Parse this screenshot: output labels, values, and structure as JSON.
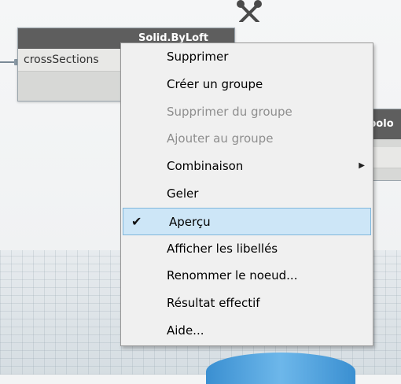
{
  "node_left": {
    "title": "Solid.ByLoft",
    "port_label": "crossSections"
  },
  "node_right": {
    "title_fragment": "polo"
  },
  "context_menu": {
    "items": [
      {
        "label": "Supprimer",
        "enabled": true
      },
      {
        "label": "Créer un groupe",
        "enabled": true
      },
      {
        "label": "Supprimer du groupe",
        "enabled": false
      },
      {
        "label": "Ajouter au groupe",
        "enabled": false
      },
      {
        "label": "Combinaison",
        "enabled": true,
        "submenu": true
      },
      {
        "label": "Geler",
        "enabled": true
      },
      {
        "label": "Aperçu",
        "enabled": true,
        "checked": true,
        "highlighted": true
      },
      {
        "label": "Afficher les libellés",
        "enabled": true
      },
      {
        "label": "Renommer le noeud...",
        "enabled": true
      },
      {
        "label": "Résultat effectif",
        "enabled": true
      },
      {
        "label": "Aide...",
        "enabled": true
      }
    ],
    "check_glyph": "✔",
    "submenu_arrow_glyph": "▶"
  },
  "icons": {
    "toolbar": "wrench-screwdriver-icon"
  },
  "colors": {
    "node_header": "#5e5e5e",
    "menu_highlight": "#cde6f7",
    "menu_highlight_border": "#7fb6db",
    "disabled_text": "#8e8e8e"
  }
}
